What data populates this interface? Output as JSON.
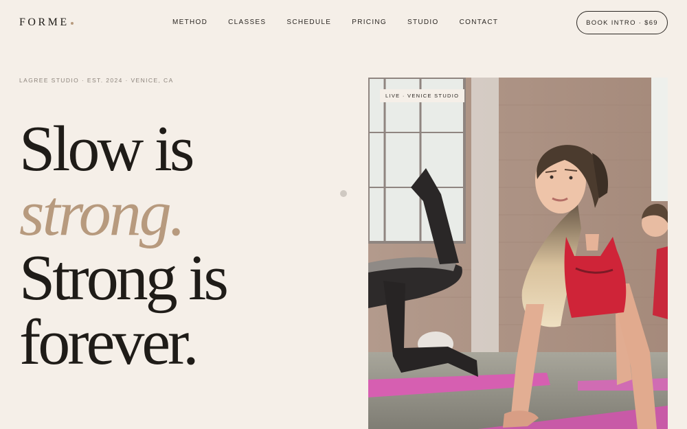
{
  "brand": {
    "name": "FORME"
  },
  "nav": {
    "items": [
      "METHOD",
      "CLASSES",
      "SCHEDULE",
      "PRICING",
      "STUDIO",
      "CONTACT"
    ]
  },
  "cta": {
    "label": "BOOK INTRO · $69"
  },
  "hero": {
    "eyebrow": "LAGREE STUDIO · EST. 2024 · VENICE, CA",
    "headline": {
      "line1": "Slow is",
      "accent": "strong.",
      "line3": "Strong is",
      "line4": "forever."
    },
    "image_badge": "LIVE · VENICE STUDIO"
  },
  "colors": {
    "background": "#f5efe8",
    "accent": "#b79a7e",
    "text": "#1f1c18"
  }
}
